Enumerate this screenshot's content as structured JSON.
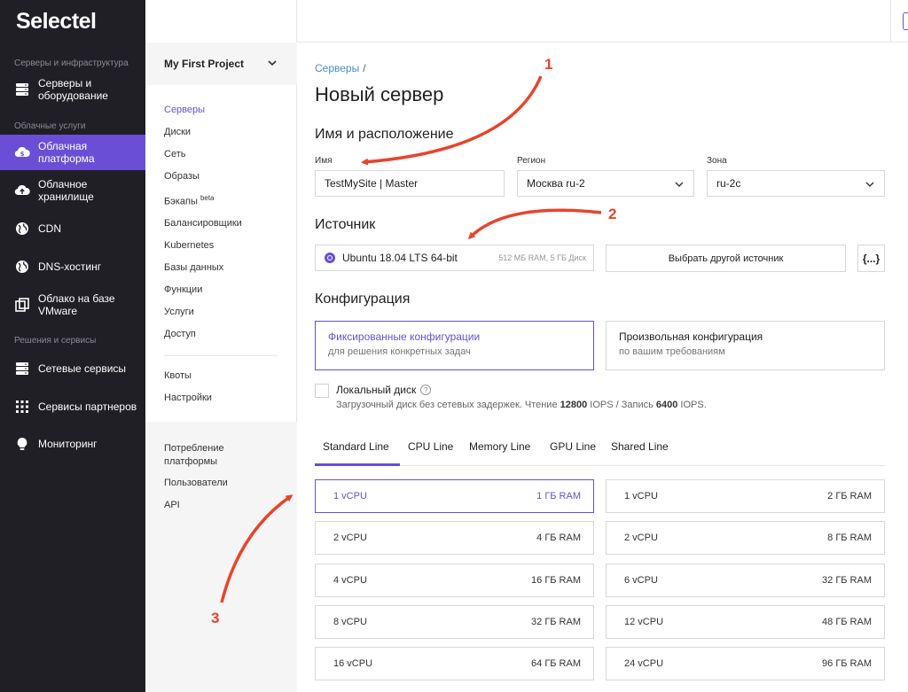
{
  "brand": "Selectel",
  "sidebar": {
    "sections": [
      "Серверы и инфраструктура",
      "Облачные услуги",
      "Решения и сервисы"
    ],
    "items": [
      {
        "label": "Серверы и оборудование",
        "icon": "server-icon"
      },
      {
        "label": "Облачная платформа",
        "icon": "cloud-platform-icon"
      },
      {
        "label": "Облачное хранилище",
        "icon": "cloud-upload-icon"
      },
      {
        "label": "CDN",
        "icon": "globe-icon"
      },
      {
        "label": "DNS-хостинг",
        "icon": "globe-icon"
      },
      {
        "label": "Облако на базе VMware",
        "icon": "vmware-icon"
      },
      {
        "label": "Сетевые сервисы",
        "icon": "network-icon"
      },
      {
        "label": "Сервисы партнеров",
        "icon": "grid-icon"
      },
      {
        "label": "Мониторинг",
        "icon": "bulb-icon"
      }
    ]
  },
  "subnav": {
    "project": "My First Project",
    "items": [
      "Серверы",
      "Диски",
      "Сеть",
      "Образы",
      "Бэкапы",
      "Балансировщики",
      "Kubernetes",
      "Базы данных",
      "Функции",
      "Услуги",
      "Доступ"
    ],
    "beta": "beta",
    "items2": [
      "Квоты",
      "Настройки"
    ],
    "items3": [
      "Потребление платформы",
      "Пользователи",
      "API"
    ]
  },
  "main": {
    "breadcrumb": "Серверы",
    "breadcrumb_sep": "/",
    "title": "Новый сервер",
    "section_location": "Имя и расположение",
    "name_label": "Имя",
    "name_value": "TestMySite | Master",
    "region_label": "Регион",
    "region_value": "Москва ru-2",
    "zone_label": "Зона",
    "zone_value": "ru-2c",
    "section_source": "Источник",
    "source_value": "Ubuntu 18.04 LTS 64-bit",
    "source_spec": "512 МБ RAM, 5 ГБ Диск",
    "source_button": "Выбрать другой источник",
    "code_button": "{...}",
    "section_config": "Конфигурация",
    "config_fixed_title": "Фиксированные конфигурации",
    "config_fixed_sub": "для решения конкретных задач",
    "config_custom_title": "Произвольная конфигурация",
    "config_custom_sub": "по вашим требованиям",
    "local_disk_label": "Локальный диск",
    "local_disk_desc_1": "Загрузочный диск без сетевых задержек. Чтение ",
    "local_disk_read": "12800",
    "local_disk_desc_2": " IOPS / Запись ",
    "local_disk_write": "6400",
    "local_disk_desc_3": " IOPS.",
    "tabs": [
      "Standard Line",
      "CPU Line",
      "Memory Line",
      "GPU Line",
      "Shared Line"
    ],
    "flavors": [
      {
        "cpu": "1 vCPU",
        "ram": "1 ГБ RAM"
      },
      {
        "cpu": "1 vCPU",
        "ram": "2 ГБ RAM"
      },
      {
        "cpu": "2 vCPU",
        "ram": "4 ГБ RAM"
      },
      {
        "cpu": "2 vCPU",
        "ram": "8 ГБ RAM"
      },
      {
        "cpu": "4 vCPU",
        "ram": "16 ГБ RAM"
      },
      {
        "cpu": "6 vCPU",
        "ram": "32 ГБ RAM"
      },
      {
        "cpu": "8 vCPU",
        "ram": "32 ГБ RAM"
      },
      {
        "cpu": "12 vCPU",
        "ram": "48 ГБ RAM"
      },
      {
        "cpu": "16 vCPU",
        "ram": "64 ГБ RAM"
      },
      {
        "cpu": "24 vCPU",
        "ram": "96 ГБ RAM"
      }
    ]
  },
  "annotations": [
    "1",
    "2",
    "3"
  ],
  "colors": {
    "accent": "#6a4fd6",
    "sidebar_bg": "#1f1f25",
    "arrow": "#e8452c",
    "link": "#4a8cc9"
  }
}
